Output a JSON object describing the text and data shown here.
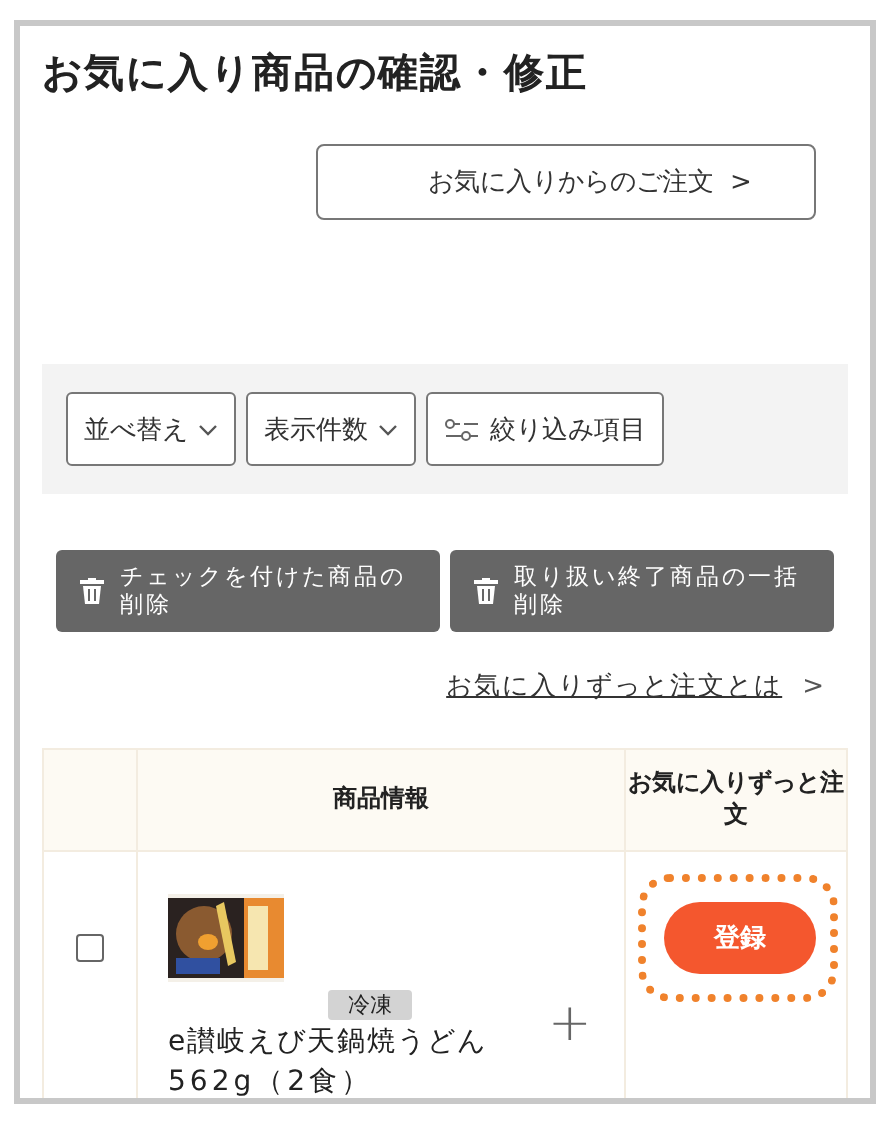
{
  "title": "お気に入り商品の確認・修正",
  "order_button": {
    "label": "お気に入りからのご注文",
    "chevron": ">"
  },
  "toolbar": [
    {
      "kind": "dropdown",
      "label": "並べ替え"
    },
    {
      "kind": "dropdown",
      "label": "表示件数"
    },
    {
      "kind": "filter",
      "label": "絞り込み項目"
    }
  ],
  "delete_buttons": [
    {
      "label": "チェックを付けた商品の削除"
    },
    {
      "label": "取り扱い終了商品の一括削除"
    }
  ],
  "info_link": {
    "label": "お気に入りずっと注文とは",
    "chevron": ">"
  },
  "table": {
    "columns": [
      "商品情報",
      "お気に入りずっと注文"
    ],
    "rows": [
      {
        "checked": false,
        "tag": "冷凍",
        "name": "e讃岐えび天鍋焼うどん",
        "size": "562g（2食）",
        "add": "+",
        "button": "登録"
      }
    ]
  }
}
